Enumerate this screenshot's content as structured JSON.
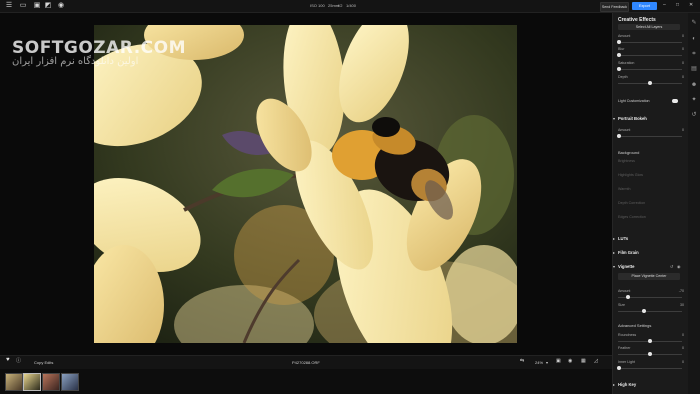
{
  "topbar": {
    "iso": "ISO 100",
    "focal": "25mm",
    "aperture": "f/2",
    "shutter": "1/400",
    "feedback_label": "Send Feedback",
    "export_label": "Export"
  },
  "watermark": {
    "title": "SOFTGOZAR.COM",
    "subtitle": "اولین دانلودگاه نرم افزار ایران"
  },
  "panel": {
    "title": "Creative Effects",
    "top_button": "Select All Layers",
    "sliders_top": [
      {
        "label": "Amount",
        "value": "0"
      },
      {
        "label": "Blur",
        "value": "0"
      },
      {
        "label": "Saturation",
        "value": "0"
      },
      {
        "label": "Depth",
        "value": "0"
      }
    ],
    "light_customization": "Light Customization",
    "portrait_bokeh": "Portrait Bokeh",
    "bokeh_amount_label": "Amount",
    "bokeh_amount_value": "0",
    "background_label": "Background",
    "background_items": [
      "Brightness",
      "Highlights Glow",
      "Warmth",
      "Depth Correction",
      "Edges Correction"
    ],
    "sections_mid": [
      "LUTs",
      "Film Grain"
    ],
    "vignette": "Vignette",
    "place_center": "Place Vignette Center",
    "vignette_sliders": [
      {
        "label": "Amount",
        "value": "-70"
      },
      {
        "label": "Size",
        "value": "30"
      }
    ],
    "advanced": "Advanced Settings",
    "advanced_sliders": [
      {
        "label": "Roundness",
        "value": "0"
      },
      {
        "label": "Feather",
        "value": "0"
      },
      {
        "label": "Inner Light",
        "value": "0"
      }
    ],
    "high_key": "High Key"
  },
  "bottombar": {
    "copy_edits": "Copy Edits",
    "filename": "P4270288.ORF",
    "zoom": "24%"
  },
  "colors": {
    "accent": "#2f87ff",
    "panel_bg": "#1b1b1b",
    "canvas_bg": "#0a0a0a"
  }
}
